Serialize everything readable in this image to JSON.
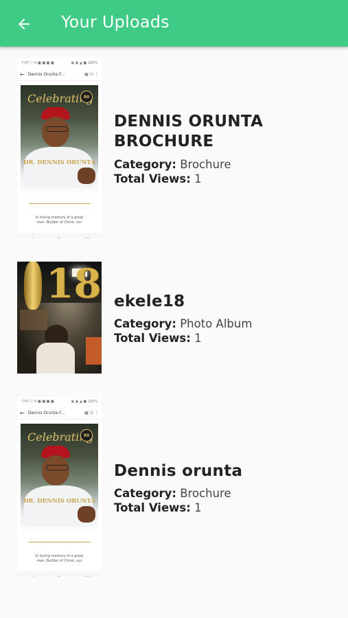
{
  "appbar": {
    "title": "Your Uploads",
    "back_icon": "arrow-left-icon",
    "color": "#3fcb86"
  },
  "labels": {
    "category": "Category:",
    "views": "Total Views:"
  },
  "uploads": [
    {
      "title": "DENNIS ORUNTA BROCHURE",
      "category": "Brochure",
      "views": "1",
      "thumb": "brochure-screenshot"
    },
    {
      "title": "ekele18",
      "category": "Photo Album",
      "views": "1",
      "thumb": "birthday-photo"
    },
    {
      "title": "Dennis orunta",
      "category": "Brochure",
      "views": "1",
      "thumb": "brochure-screenshot"
    }
  ],
  "thumb_text": {
    "app_bar_title": "Dennis Orunta F...",
    "poster_script": "Celebrating",
    "poster_badge": "80",
    "poster_name": "DR. DENNIS ORUNTA",
    "memory_text": "In loving memory of a great man, Builder of Christ, our",
    "balloon_text": "18"
  }
}
